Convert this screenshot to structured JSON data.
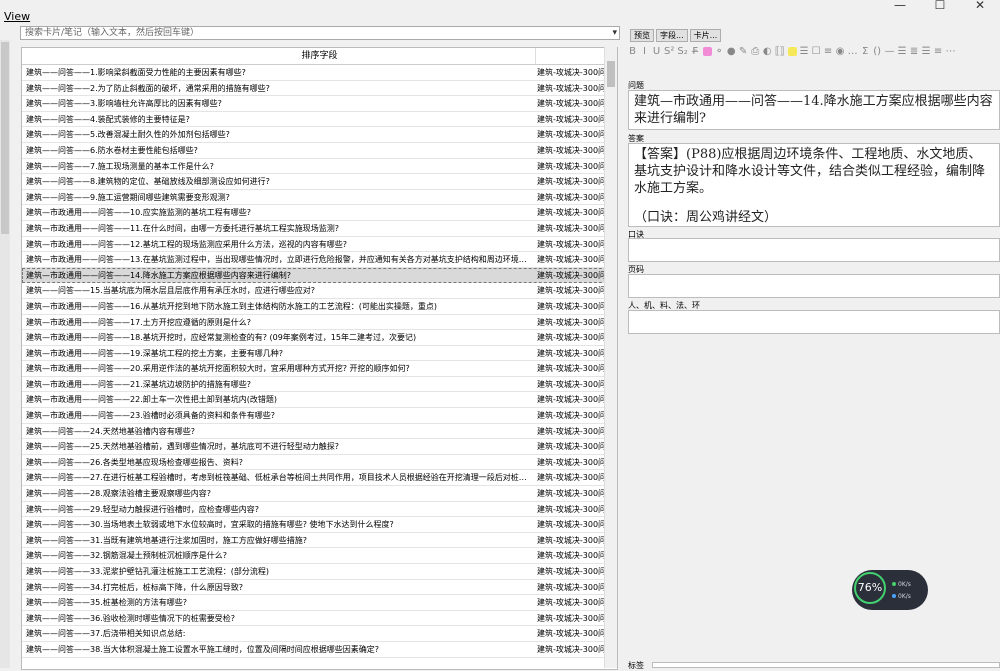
{
  "window": {
    "minimize": "—",
    "maximize": "☐",
    "close": "✕"
  },
  "menu": {
    "view": "View"
  },
  "search": {
    "placeholder": "搜索卡片/笔记（输入文本，然后按回车键）",
    "dropdown_icon": "chevron-down-icon"
  },
  "table": {
    "header": "排序字段",
    "rows": [
      {
        "q": "建筑——问答——1.影响梁斜截面受力性能的主要因素有哪些?",
        "d": "建筑-攻城决-300问"
      },
      {
        "q": "建筑——问答——2.为了防止斜截面的破坏，通常采用的措施有哪些?",
        "d": "建筑-攻城决-300问"
      },
      {
        "q": "建筑——问答——3.影响墙柱允许高厚比的因素有哪些?",
        "d": "建筑-攻城决-300问"
      },
      {
        "q": "建筑——问答——4.装配式装修的主要特征是?",
        "d": "建筑-攻城决-300问"
      },
      {
        "q": "建筑——问答——5.改善混凝土耐久性的外加剂包括哪些?",
        "d": "建筑-攻城决-300问"
      },
      {
        "q": "建筑——问答——6.防水卷材主要性能包括哪些?",
        "d": "建筑-攻城决-300问"
      },
      {
        "q": "建筑——问答——7.施工现场测量的基本工作是什么?",
        "d": "建筑-攻城决-300问"
      },
      {
        "q": "建筑——问答——8.建筑物的定位、基础放线及细部测设应如何进行?",
        "d": "建筑-攻城决-300问"
      },
      {
        "q": "建筑——问答——9.施工运营期间哪些建筑需要变形观测?",
        "d": "建筑-攻城决-300问"
      },
      {
        "q": "建筑—市政通用——问答——10.应实施监测的基坑工程有哪些?",
        "d": "建筑-攻城决-300问"
      },
      {
        "q": "建筑—市政通用——问答——11.在什么时间，由哪一方委托进行基坑工程实施现场监测?",
        "d": "建筑-攻城决-300问"
      },
      {
        "q": "建筑—市政通用——问答——12.基坑工程的现场监测应采用什么方法，巡视的内容有哪些?",
        "d": "建筑-攻城决-300问"
      },
      {
        "q": "建筑—市政通用——问答——13.在基坑监测过程中，当出现哪些情况时，立即进行危险报警，并应通知有关各方对基坑支护结构和周边环境保护对...",
        "d": "建筑-攻城决-300问"
      },
      {
        "q": "建筑—市政通用——问答——14.降水施工方案应根据哪些内容来进行编制?",
        "d": "建筑-攻城决-300问",
        "selected": true
      },
      {
        "q": "建筑——问答——15.当基坑底为隔水层且层底作用有承压水时，应进行哪些应对?",
        "d": "建筑-攻城决-300问"
      },
      {
        "q": "建筑—市政通用——问答——16.从基坑开挖到地下防水施工到主体结构防水施工的工艺流程：(可能出实操题，重点)",
        "d": "建筑-攻城决-300问"
      },
      {
        "q": "建筑—市政通用——问答——17.土方开挖应遵循的原则是什么?",
        "d": "建筑-攻城决-300问"
      },
      {
        "q": "建筑—市政通用——问答——18.基坑开挖时，应经常复测检查的有? (09年案例考过，15年二建考过，次要记)",
        "d": "建筑-攻城决-300问"
      },
      {
        "q": "建筑—市政通用——问答——19.深基坑工程的挖土方案，主要有哪几种?",
        "d": "建筑-攻城决-300问"
      },
      {
        "q": "建筑—市政通用——问答——20.采用逆作法的基坑开挖面积较大时，宜采用哪种方式开挖? 开挖的顺序如何?",
        "d": "建筑-攻城决-300问"
      },
      {
        "q": "建筑—市政通用——问答——21.深基坑边坡防护的措施有哪些?",
        "d": "建筑-攻城决-300问"
      },
      {
        "q": "建筑—市政通用——问答——22.卸土车一次性把土卸到基坑内(改错题)",
        "d": "建筑-攻城决-300问"
      },
      {
        "q": "建筑—市政通用——问答——23.验槽时必须具备的资料和条件有哪些?",
        "d": "建筑-攻城决-300问"
      },
      {
        "q": "建筑——问答——24.天然地基验槽内容有哪些?",
        "d": "建筑-攻城决-300问"
      },
      {
        "q": "建筑——问答——25.天然地基验槽前，遇到哪些情况时，基坑底可不进行轻型动力触探?",
        "d": "建筑-攻城决-300问"
      },
      {
        "q": "建筑——问答——26.各类型地基应现场检查哪些报告、资料?",
        "d": "建筑-攻城决-300问"
      },
      {
        "q": "建筑——问答——27.在进行桩基工程验槽时，考虑到桩筏基础、低桩承台等桩间土共同作用，项目技术人员根据经验在开挖清理一段后对桩间土进...",
        "d": "建筑-攻城决-300问"
      },
      {
        "q": "建筑——问答——28.观察法验槽主要观察哪些内容?",
        "d": "建筑-攻城决-300问"
      },
      {
        "q": "建筑——问答——29.轻型动力触探进行验槽时，应检查哪些内容?",
        "d": "建筑-攻城决-300问"
      },
      {
        "q": "建筑——问答——30.当场地表土软弱或地下水位较高时，宜采取的措施有哪些? 使地下水达到什么程度?",
        "d": "建筑-攻城决-300问"
      },
      {
        "q": "建筑——问答——31.当既有建筑地基进行注浆加固时，施工方应做好哪些措施?",
        "d": "建筑-攻城决-300问"
      },
      {
        "q": "建筑——问答——32.钢筋混凝土预制桩沉桩顺序是什么?",
        "d": "建筑-攻城决-300问"
      },
      {
        "q": "建筑——问答——33.泥浆护壁钻孔灌注桩施工工艺流程：(部分流程)",
        "d": "建筑-攻城决-300问"
      },
      {
        "q": "建筑——问答——34.打完桩后，桩标高下降，什么原因导致?",
        "d": "建筑-攻城决-300问"
      },
      {
        "q": "建筑——问答——35.桩基检测的方法有哪些?",
        "d": "建筑-攻城决-300问"
      },
      {
        "q": "建筑——问答——36.验收检测时哪些情况下的桩需要受检?",
        "d": "建筑-攻城决-300问"
      },
      {
        "q": "建筑——问答——37.后浇带相关知识点总结:",
        "d": "建筑-攻城决-300问"
      },
      {
        "q": "建筑——问答——38.当大体积混凝土施工设置水平施工缝时，位置及间隔时间应根据哪些因素确定?",
        "d": "建筑-攻城决-300问"
      }
    ]
  },
  "editor": {
    "preview_btn": "预览",
    "fields_btn": "字段...",
    "cards_btn": "卡片...",
    "toolbar": [
      "B",
      "I",
      "U",
      "S²",
      "S₂",
      "F̶",
      "⚬",
      "●",
      "✎",
      "⎙",
      "◐",
      "⟦⟧",
      "☰",
      "☐",
      "≡",
      "◉",
      "…",
      "Σ",
      "()",
      "—",
      "☰",
      "≣",
      "☰",
      "≡",
      "⋯"
    ],
    "colors": {
      "pink": "#f28cd6",
      "green": "#9fe07b",
      "purple": "#a896ff",
      "yellow": "#f5e95a",
      "orange": "#f7a35a"
    },
    "q_label": "问题",
    "q_value": "建筑—市政通用——问答——14.降水施工方案应根据哪些内容来进行编制?",
    "a_label": "答案",
    "a_value": "【答案】(P88)应根据周边环境条件、工程地质、水文地质、基坑支护设计和降水设计等文件，结合类似工程经验，编制降水施工方案。",
    "a_note": "（口诀：周公鸡讲经文）",
    "f3_label": "口诀",
    "f4_label": "页码",
    "f5_label": "人、机、料、法、环",
    "bottom_label": "标签"
  },
  "gauge": {
    "percent": "76%",
    "up": "0K/s",
    "down": "0K/s"
  }
}
